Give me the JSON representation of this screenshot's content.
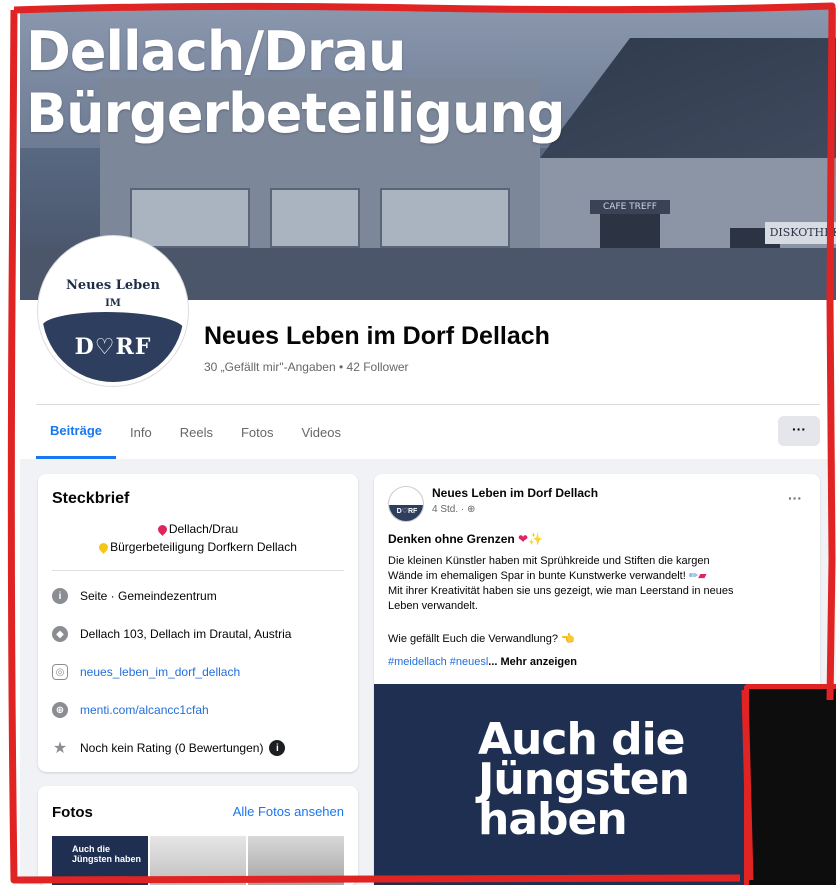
{
  "cover": {
    "title_line1": "Dellach/Drau",
    "title_line2": "Bürgerbeteiligung",
    "sign_cafe": "CAFE TREFF",
    "sign_disco": "DISKOTHEK"
  },
  "avatar": {
    "line1": "Neues Leben",
    "line2": "IM",
    "line3": "D♡RF"
  },
  "page": {
    "name": "Neues Leben im Dorf Dellach",
    "stats": "30 „Gefällt mir\"-Angaben • 42 Follower"
  },
  "tabs": [
    {
      "label": "Beiträge",
      "active": true
    },
    {
      "label": "Info"
    },
    {
      "label": "Reels"
    },
    {
      "label": "Fotos"
    },
    {
      "label": "Videos"
    }
  ],
  "more_button": "···",
  "intro": {
    "title": "Steckbrief",
    "bio_line1": "Dellach/Drau",
    "bio_line2": "Bürgerbeteiligung Dorfkern Dellach",
    "rows": [
      {
        "icon": "info-icon",
        "text": "Seite · Gemeindezentrum"
      },
      {
        "icon": "location-icon",
        "text": "Dellach 103, Dellach im Drautal, Austria"
      },
      {
        "icon": "instagram-icon",
        "text": "neues_leben_im_dorf_dellach"
      },
      {
        "icon": "globe-icon",
        "text": "menti.com/alcancc1cfah"
      },
      {
        "icon": "star-icon",
        "text": "Noch kein Rating (0 Bewertungen)"
      }
    ]
  },
  "photos": {
    "title": "Fotos",
    "see_all": "Alle Fotos ansehen",
    "thumb1_text": "Auch die Jüngsten haben"
  },
  "post": {
    "author": "Neues Leben im Dorf Dellach",
    "time": "4 Std. · ",
    "avatar_text": "D♡RF",
    "headline": "Denken ohne Grenzen",
    "body_line1": "Die kleinen Künstler haben mit Sprühkreide und Stiften die kargen",
    "body_line2": "Wände im ehemaligen Spar in bunte Kunstwerke verwandelt!",
    "body_line3": "Mit ihrer Kreativität haben sie uns gezeigt, wie man Leerstand in neues",
    "body_line4": "Leben verwandelt.",
    "question": "Wie gefällt Euch die Verwandlung?",
    "hashtags": "#meidellach #neuesl",
    "see_more": "... Mehr anzeigen",
    "image_line1": "Auch die",
    "image_line2": "Jüngsten",
    "image_line3": "haben"
  },
  "colors": {
    "accent": "#1877f2",
    "border_annotation": "#e02424",
    "brand_navy": "#1e2f52"
  }
}
